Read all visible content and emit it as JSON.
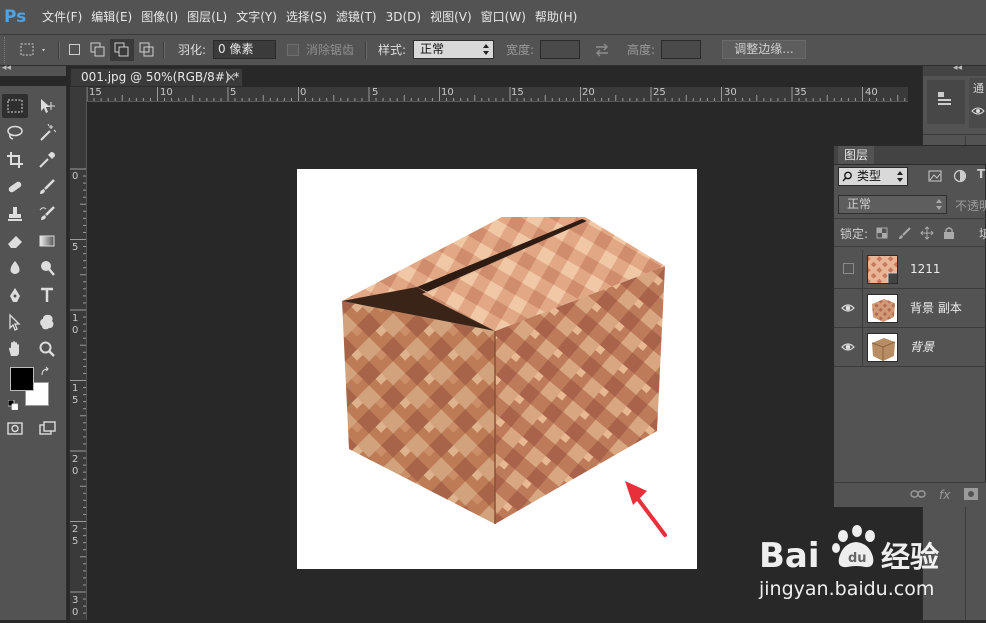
{
  "app": {
    "logo": "Ps"
  },
  "menu": [
    "文件(F)",
    "编辑(E)",
    "图像(I)",
    "图层(L)",
    "文字(Y)",
    "选择(S)",
    "滤镜(T)",
    "3D(D)",
    "视图(V)",
    "窗口(W)",
    "帮助(H)"
  ],
  "options": {
    "feather_label": "羽化:",
    "feather_value": "0 像素",
    "antialias_label": "消除锯齿",
    "style_label": "样式:",
    "style_value": "正常",
    "width_label": "宽度:",
    "height_label": "高度:",
    "refine_button": "调整边缘..."
  },
  "document": {
    "tab_title": "001.jpg @ 50%(RGB/8#) *",
    "close": "×"
  },
  "ruler": {
    "top": [
      "15",
      "10",
      "5",
      "0",
      "5",
      "10",
      "15",
      "20",
      "25",
      "30",
      "35",
      "40"
    ],
    "left": [
      "0",
      "5",
      "1 0",
      "1 5",
      "2 0",
      "2 5",
      "3 0"
    ]
  },
  "layers_panel": {
    "tab": "图层",
    "filter_label": "类型",
    "blend_mode": "正常",
    "opacity_label": "不透明",
    "lock_label": "锁定:",
    "fill_label": "填",
    "layers": [
      {
        "name": "1211",
        "visible": false,
        "thumb": "pattern"
      },
      {
        "name": "背景 副本",
        "visible": true,
        "thumb": "box-pattern"
      },
      {
        "name": "背景",
        "visible": true,
        "thumb": "box"
      }
    ],
    "footer_icons": [
      "link-icon",
      "fx-icon",
      "mask-icon"
    ],
    "footer_fx": "fx"
  },
  "right_strip": {
    "tab_partial": "通"
  },
  "watermark": {
    "brand": "Baidu",
    "brand_cn": "经验",
    "url": "jingyan.baidu.com"
  },
  "colors": {
    "menubar": "#535353",
    "workspace": "#282828",
    "panel": "#535353",
    "accent_ps": "#4fa3e3",
    "arrow": "#e8303a"
  }
}
